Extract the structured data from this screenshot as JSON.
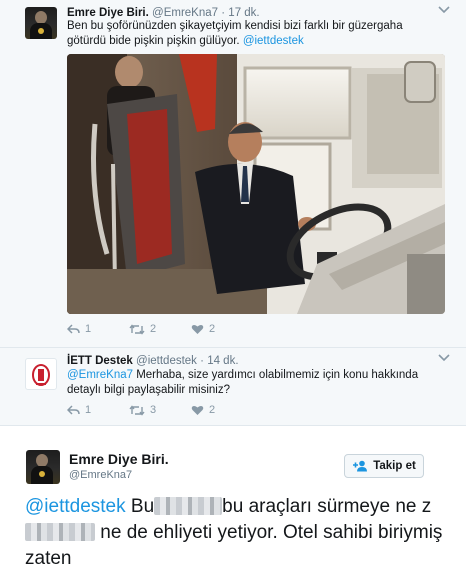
{
  "tweet1": {
    "name": "Emre Diye Biri.",
    "handle": "@EmreKna7",
    "dot": "·",
    "time": "17 dk.",
    "text_main": "Ben bu şoförünüzden şikayetçiyim kendisi bizi farklı bir güzergaha götürdü bide pişkin pişkin gülüyor. ",
    "mention": "@iettdestek",
    "replies": "1",
    "retweets": "2",
    "likes": "2"
  },
  "tweet2": {
    "name": "İETT Destek",
    "handle": "@iettdestek",
    "dot": "·",
    "time": "14 dk.",
    "mention": "@EmreKna7",
    "text_main": " Merhaba, size yardımcı olabilmemiz için konu hakkında detaylı bilgi paylaşabilir misiniz?",
    "replies": "1",
    "retweets": "3",
    "likes": "2"
  },
  "tweet3": {
    "name": "Emre Diye Biri.",
    "handle": "@EmreKna7",
    "follow_label": "Takip et",
    "mention": "@iettdestek",
    "text_a": " Bu",
    "text_b": "bu araçları sürmeye ne z",
    "text_c": " ne de ehliyeti yetiyor. Otel sahibi biriymiş zaten"
  },
  "colors": {
    "link": "#1b95e0",
    "muted": "#657786",
    "icon": "#8899a6",
    "reply_bg": "#f5f8fa"
  },
  "icons": [
    "chevron-down-icon",
    "reply-icon",
    "retweet-icon",
    "like-icon",
    "follow-icon"
  ]
}
